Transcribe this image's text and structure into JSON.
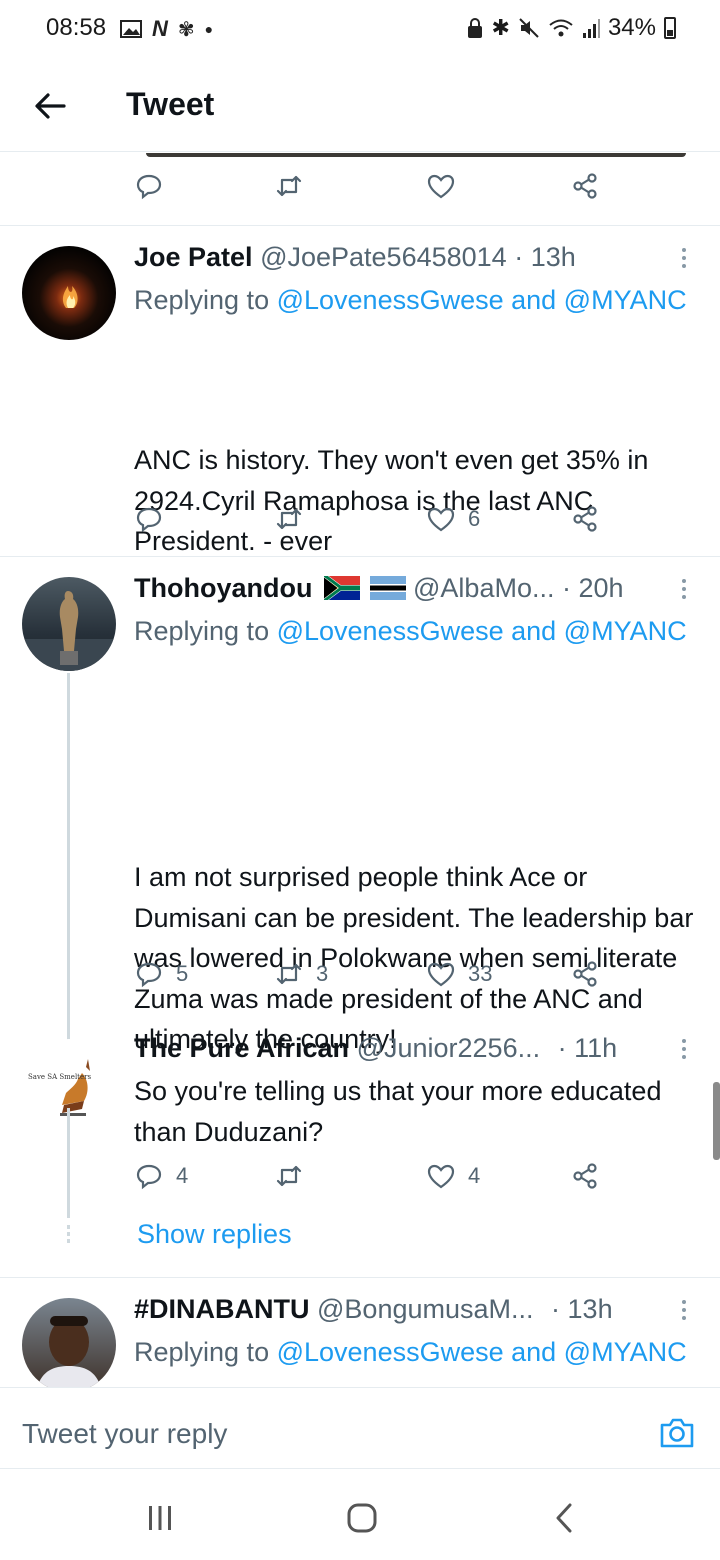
{
  "status_bar": {
    "time": "08:58",
    "battery": "34%"
  },
  "header": {
    "title": "Tweet"
  },
  "tweets": [
    {
      "id": "top",
      "stats": {
        "reply": "",
        "retweet": "",
        "like": ""
      }
    },
    {
      "id": "joe",
      "name": "Joe Patel",
      "handle": "@JoePate56458014",
      "time": "· 13h",
      "replying_prefix": "Replying to ",
      "replying_mentions": "@LovenessGwese and @MYANC",
      "text": "ANC is history. They won't even get 35% in 2924.Cyril Ramaphosa is the last ANC President. - ever",
      "stats": {
        "reply": "",
        "retweet": "",
        "like": "6"
      }
    },
    {
      "id": "thoho",
      "name": "Thohoyandou",
      "flags": [
        "South Africa flag",
        "Botswana flag"
      ],
      "handle": "@AlbaMo...",
      "time": "· 20h",
      "replying_prefix": "Replying to ",
      "replying_mentions": "@LovenessGwese and @MYANC",
      "text": "I am not surprised people think Ace or Dumisani can be president. The leadership bar was lowered in Polokwane when semi literate Zuma was made president of the ANC and ultimately the country!",
      "stats": {
        "reply": "5",
        "retweet": "3",
        "like": "33"
      }
    },
    {
      "id": "pure",
      "name": "The Pure African",
      "handle": "@Junior2256...",
      "time": "· 11h",
      "avatar_text": "Save SA Smelters",
      "text": "So you're telling us that your more educated than Duduzani?",
      "stats": {
        "reply": "4",
        "retweet": "",
        "like": "4"
      }
    },
    {
      "id": "dina",
      "name": "#DINABANTU",
      "handle": "@BongumusaM...",
      "time": "· 13h",
      "replying_prefix": "Replying to ",
      "replying_mentions": "@LovenessGwese and @MYANC"
    }
  ],
  "show_replies": "Show replies",
  "composer": {
    "placeholder": "Tweet your reply"
  },
  "icons": {
    "back": "arrow-left-icon",
    "reply": "reply-bubble-icon",
    "retweet": "retweet-icon",
    "like": "heart-icon",
    "share": "share-icon",
    "camera": "camera-icon"
  },
  "colors": {
    "accent": "#1d9bf0",
    "muted": "#536471",
    "text": "#0f1419"
  }
}
